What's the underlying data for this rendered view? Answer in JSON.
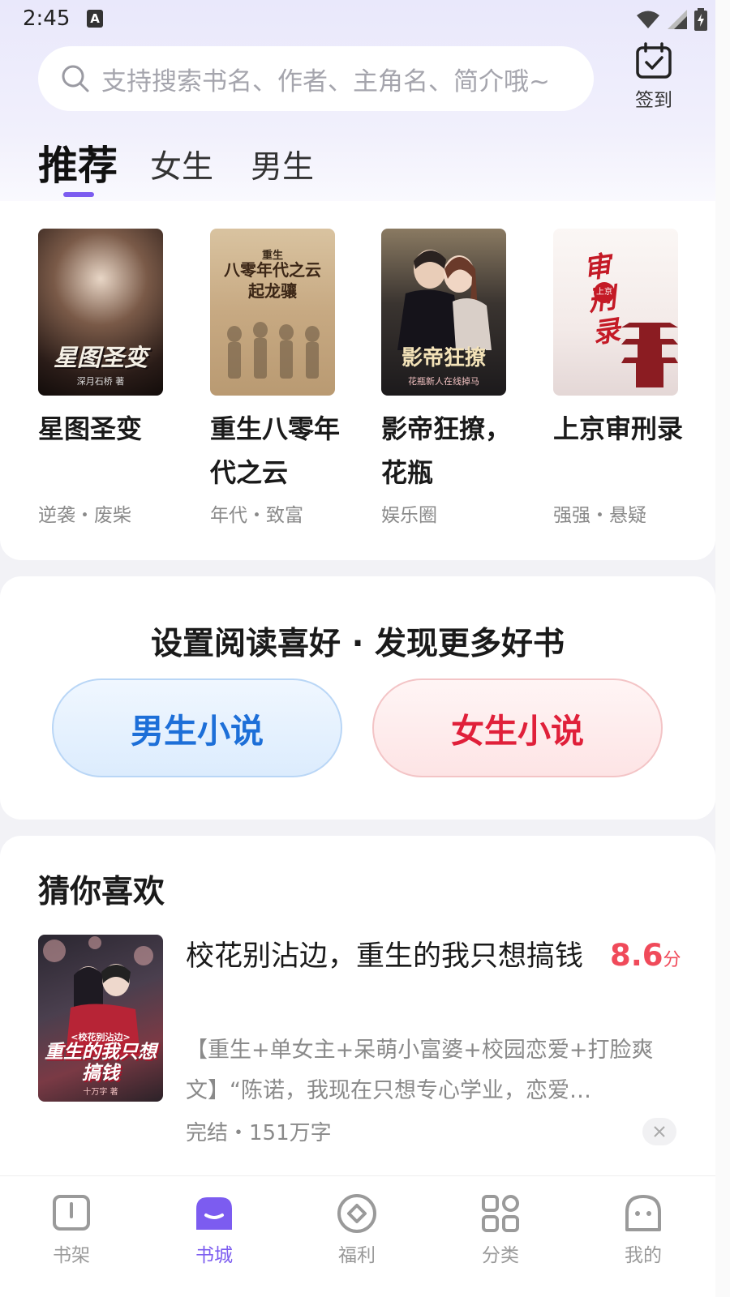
{
  "status_bar": {
    "time": "2:45",
    "input_indicator": "A"
  },
  "search": {
    "placeholder": "支持搜索书名、作者、主角名、简介哦~"
  },
  "checkin": {
    "label": "签到"
  },
  "tabs": [
    {
      "label": "推荐",
      "active": true
    },
    {
      "label": "女生",
      "active": false
    },
    {
      "label": "男生",
      "active": false
    }
  ],
  "featured_books": [
    {
      "title": "星图圣变",
      "cover_text": "星图圣变",
      "cover_sub": "深月石桥 著",
      "tags": "逆袭・废柴"
    },
    {
      "title": "重生八零年代之云",
      "cover_text": "八零年代之云起龙骧",
      "cover_sub": "重生",
      "tags": "年代・致富"
    },
    {
      "title": "影帝狂撩，花瓶",
      "cover_text": "影帝狂撩",
      "cover_sub": "花瓶新人在线掉马",
      "tags": "娱乐圈"
    },
    {
      "title": "上京审刑录",
      "cover_text": "审刑录",
      "cover_sub": "上京",
      "tags": "强强・悬疑"
    }
  ],
  "preference": {
    "title": "设置阅读喜好 · 发现更多好书",
    "male_button": "男生小说",
    "female_button": "女生小说"
  },
  "guess": {
    "section_title": "猜你喜欢",
    "book": {
      "title": "校花别沾边，重生的我只想搞钱",
      "cover_text": "重生的我只想搞钱",
      "cover_small": "<校花别沾边>",
      "cover_author": "十万字 著",
      "score": "8.6",
      "score_unit": "分",
      "description": "【重生+单女主+呆萌小富婆+校园恋爱+打脸爽文】“陈诺，我现在只想专心学业，恋爱…",
      "meta": "完结・151万字"
    }
  },
  "bottom_nav": [
    {
      "label": "书架",
      "icon": "bookshelf-icon",
      "active": false
    },
    {
      "label": "书城",
      "icon": "bookstore-icon",
      "active": true
    },
    {
      "label": "福利",
      "icon": "welfare-icon",
      "active": false
    },
    {
      "label": "分类",
      "icon": "category-icon",
      "active": false
    },
    {
      "label": "我的",
      "icon": "profile-icon",
      "active": false
    }
  ],
  "colors": {
    "accent": "#7c5cf0",
    "score": "#f04a5a",
    "male": "#1d6fd8",
    "female": "#e0203a"
  }
}
